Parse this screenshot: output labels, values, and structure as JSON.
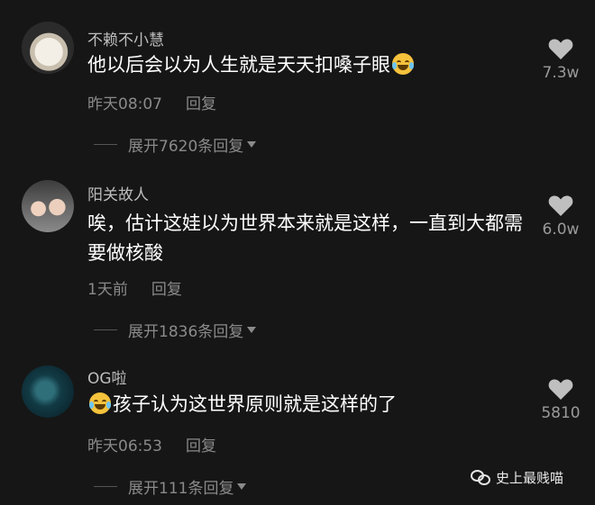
{
  "comments": [
    {
      "username": "不赖不小慧",
      "text_before": "他以后会以为人生就是天天扣嗓子眼",
      "emoji": "crying-laughing-emoji",
      "time": "昨天08:07",
      "reply": "回复",
      "expand": "展开7620条回复",
      "likes": "7.3w"
    },
    {
      "username": "阳关故人",
      "text": "唉，估计这娃以为世界本来就是这样，一直到大都需要做核酸",
      "time": "1天前",
      "reply": "回复",
      "expand": "展开1836条回复",
      "likes": "6.0w"
    },
    {
      "username": "OG啦",
      "emoji": "crying-laughing-emoji",
      "text_after": "孩子认为这世界原则就是这样的了",
      "time": "昨天06:53",
      "reply": "回复",
      "expand": "展开111条回复",
      "likes": "5810"
    }
  ],
  "watermark": "史上最贱喵",
  "colors": {
    "background": "#161616",
    "text": "#ffffff",
    "secondary": "#8a8a8a",
    "heart": "#bfbfbf"
  }
}
